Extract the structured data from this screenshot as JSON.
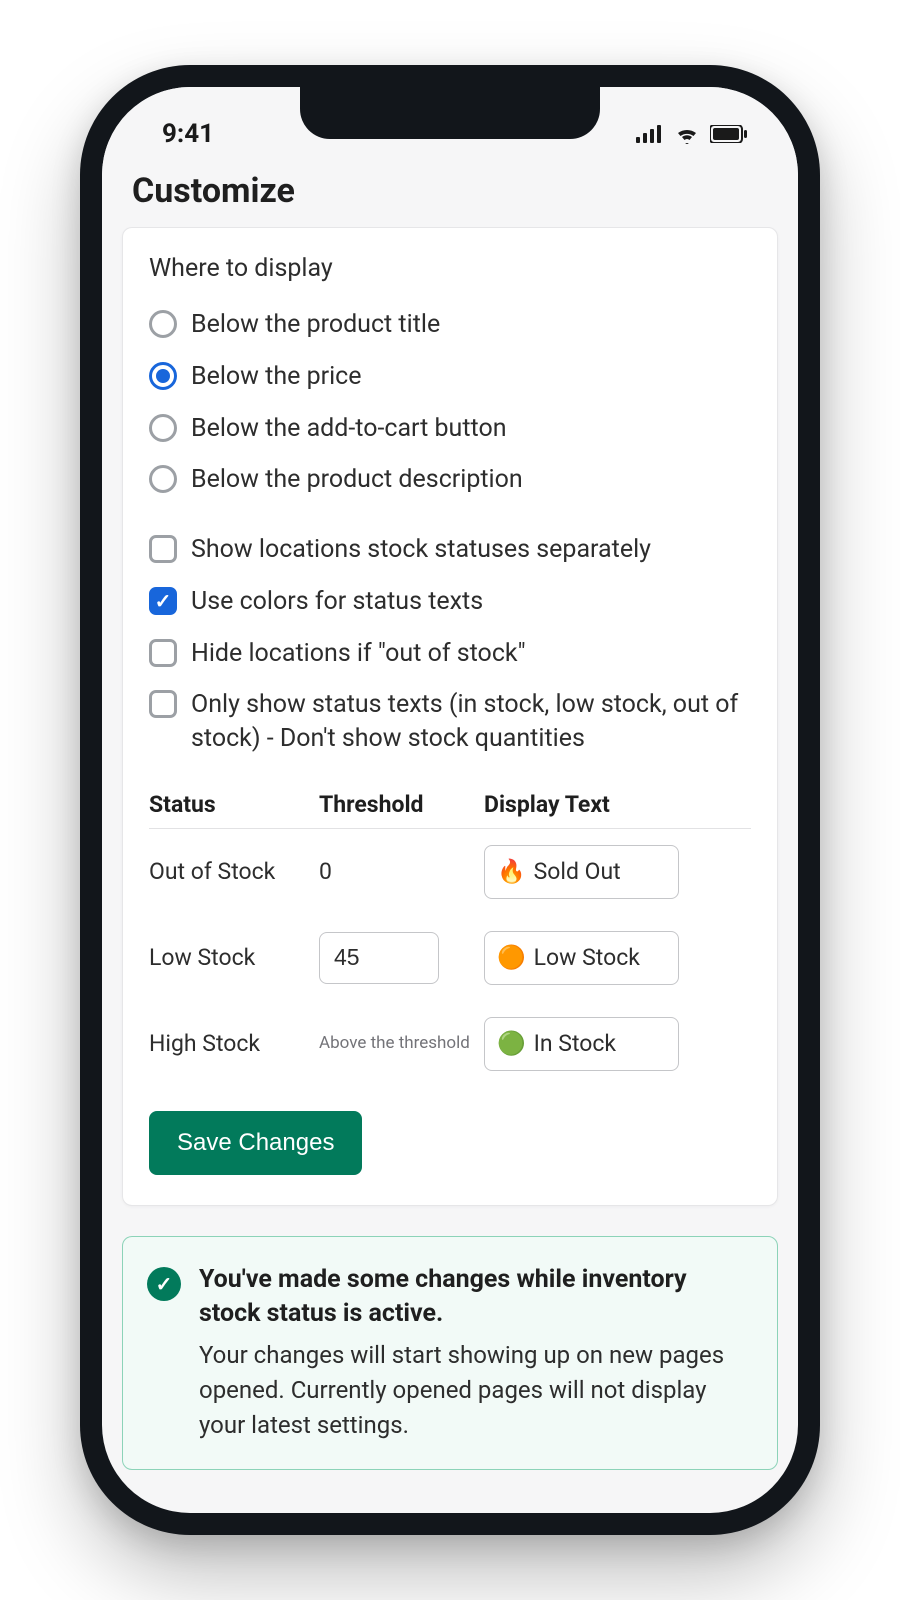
{
  "status": {
    "time": "9:41"
  },
  "page": {
    "title": "Customize"
  },
  "where": {
    "label": "Where to display",
    "options": [
      {
        "label": "Below the product title",
        "selected": false
      },
      {
        "label": "Below the price",
        "selected": true
      },
      {
        "label": "Below the add-to-cart button",
        "selected": false
      },
      {
        "label": "Below the product description",
        "selected": false
      }
    ]
  },
  "checks": [
    {
      "label": "Show locations stock statuses separately",
      "checked": false
    },
    {
      "label": "Use colors for status texts",
      "checked": true
    },
    {
      "label": "Hide locations if \"out of stock\"",
      "checked": false
    },
    {
      "label": "Only show status texts (in stock, low stock, out of stock) - Don't show stock quantities",
      "checked": false
    }
  ],
  "table": {
    "headers": {
      "status": "Status",
      "threshold": "Threshold",
      "display": "Display Text"
    },
    "rows": [
      {
        "status": "Out of Stock",
        "threshold": "0",
        "threshold_editable": false,
        "icon": "🔥",
        "display": "Sold Out"
      },
      {
        "status": "Low Stock",
        "threshold": "45",
        "threshold_editable": true,
        "icon": "🟠",
        "display": "Low Stock"
      },
      {
        "status": "High Stock",
        "threshold": "Above the threshold",
        "threshold_editable": false,
        "threshold_is_note": true,
        "icon": "🟢",
        "display": "In Stock"
      }
    ]
  },
  "save": {
    "label": "Save Changes"
  },
  "banner": {
    "title": "You've made some changes while inventory stock status is active.",
    "body": "Your changes will start showing up on new pages opened. Currently opened pages will not display your latest settings."
  }
}
